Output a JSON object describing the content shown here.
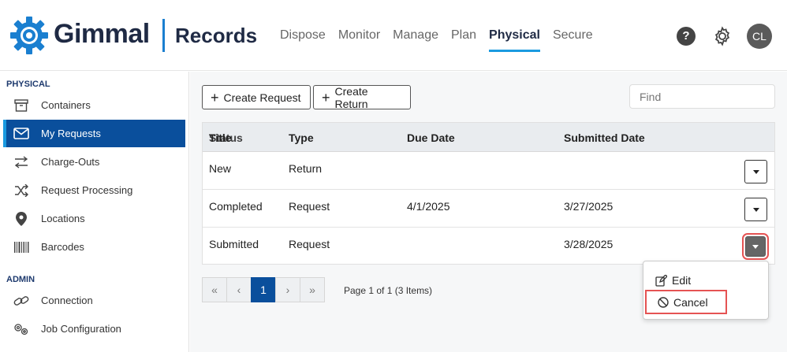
{
  "header": {
    "brand": "Gimmal",
    "product": "Records",
    "nav": [
      "Dispose",
      "Monitor",
      "Manage",
      "Plan",
      "Physical",
      "Secure"
    ],
    "active_nav": "Physical",
    "help_label": "?",
    "avatar_initials": "CL",
    "brand_color": "#1a7fd0"
  },
  "sidebar": {
    "physical_label": "PHYSICAL",
    "physical_items": [
      {
        "label": "Containers",
        "icon": "archive-box-icon"
      },
      {
        "label": "My Requests",
        "icon": "envelope-icon"
      },
      {
        "label": "Charge-Outs",
        "icon": "swap-arrows-icon"
      },
      {
        "label": "Request Processing",
        "icon": "shuffle-icon"
      },
      {
        "label": "Locations",
        "icon": "map-pin-icon"
      },
      {
        "label": "Barcodes",
        "icon": "barcode-icon"
      }
    ],
    "admin_label": "ADMIN",
    "admin_items": [
      {
        "label": "Connection",
        "icon": "link-icon"
      },
      {
        "label": "Job Configuration",
        "icon": "gears-icon"
      }
    ],
    "active_item": "My Requests",
    "active_color": "#0a4f9c"
  },
  "toolbar": {
    "create_request": "Create Request",
    "create_return": "Create Return",
    "find_placeholder": "Find"
  },
  "table": {
    "headers": {
      "status_overlap_a": "Title",
      "status": "Status",
      "type": "Type",
      "due_date": "Due Date",
      "submitted_date": "Submitted Date"
    },
    "rows": [
      {
        "status": "New",
        "type": "Return",
        "due_date": "",
        "submitted_date": ""
      },
      {
        "status": "Completed",
        "type": "Request",
        "due_date": "4/1/2025",
        "submitted_date": "3/27/2025"
      },
      {
        "status": "Submitted",
        "type": "Request",
        "due_date": "",
        "submitted_date": "3/28/2025"
      }
    ]
  },
  "pager": {
    "first": "«",
    "prev": "‹",
    "current": "1",
    "next": "›",
    "last": "»",
    "info": "Page 1 of 1 (3 Items)"
  },
  "menu": {
    "edit": "Edit",
    "cancel": "Cancel"
  }
}
